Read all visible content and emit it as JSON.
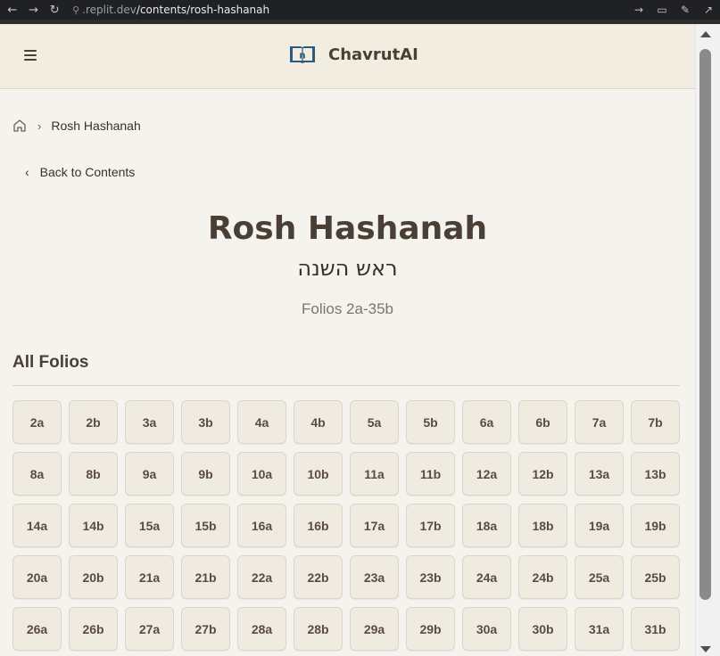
{
  "browser": {
    "url_host": ".replit.dev",
    "url_path": "/contents/rosh-hashanah"
  },
  "header": {
    "brand_name": "ChavrutAI",
    "logo_letter": "ח"
  },
  "breadcrumb": {
    "current": "Rosh Hashanah"
  },
  "back_link": {
    "label": "Back to Contents"
  },
  "tractate": {
    "title": "Rosh Hashanah",
    "hebrew_title": "ראש השנה",
    "folios_range": "Folios 2a-35b"
  },
  "folios_section": {
    "heading": "All Folios",
    "items": [
      "2a",
      "2b",
      "3a",
      "3b",
      "4a",
      "4b",
      "5a",
      "5b",
      "6a",
      "6b",
      "7a",
      "7b",
      "8a",
      "8b",
      "9a",
      "9b",
      "10a",
      "10b",
      "11a",
      "11b",
      "12a",
      "12b",
      "13a",
      "13b",
      "14a",
      "14b",
      "15a",
      "15b",
      "16a",
      "16b",
      "17a",
      "17b",
      "18a",
      "18b",
      "19a",
      "19b",
      "20a",
      "20b",
      "21a",
      "21b",
      "22a",
      "22b",
      "23a",
      "23b",
      "24a",
      "24b",
      "25a",
      "25b",
      "26a",
      "26b",
      "27a",
      "27b",
      "28a",
      "28b",
      "29a",
      "29b",
      "30a",
      "30b",
      "31a",
      "31b"
    ]
  },
  "colors": {
    "background": "#f5f3ee",
    "header_bg": "#f1ede1",
    "text_primary": "#4a3f35",
    "logo_blue": "#2d5a7b"
  }
}
